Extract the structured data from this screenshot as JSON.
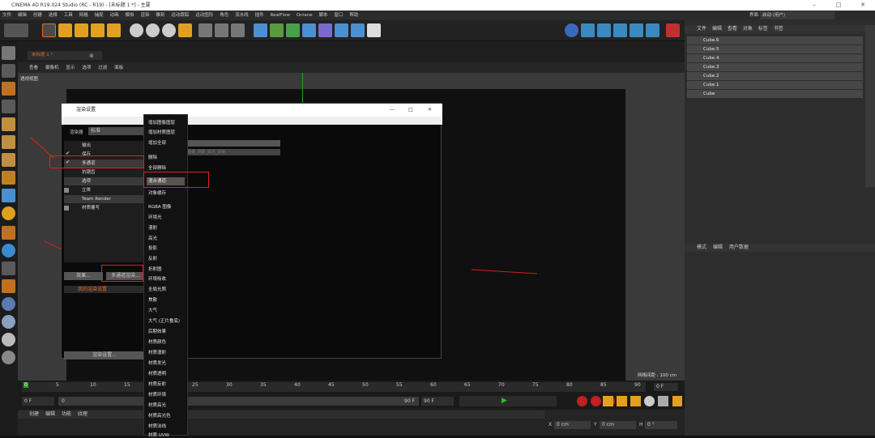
{
  "window": {
    "title": "CINEMA 4D R19.024 Studio (RC - R19) - [未标题 1 *] - 主要"
  },
  "menubar": [
    "文件",
    "编辑",
    "创建",
    "选择",
    "工具",
    "网格",
    "捕捉",
    "动画",
    "模拟",
    "渲染",
    "雕刻",
    "运动跟踪",
    "运动图形",
    "角色",
    "流水线",
    "插件",
    "RealFlow",
    "Octane",
    "脚本",
    "窗口",
    "帮助"
  ],
  "layout": {
    "label": "界面",
    "value": "启动 (用户)"
  },
  "viewport": {
    "tab": "未标题 1 *",
    "menu": [
      "查看",
      "摄像机",
      "显示",
      "选项",
      "过滤",
      "面板"
    ],
    "view_label": "透视视图",
    "grid_spacing": "网格间距 : 100 cm"
  },
  "object_manager": {
    "menu": [
      "文件",
      "编辑",
      "查看",
      "对象",
      "标签",
      "书签"
    ],
    "objects": [
      "Cube.6",
      "Cube.5",
      "Cube.4",
      "Cube.3",
      "Cube.2",
      "Cube.1",
      "Cube"
    ]
  },
  "attribute_manager": {
    "menu": [
      "模式",
      "编辑",
      "用户数据"
    ]
  },
  "render_dialog": {
    "title": "渲染设置",
    "renderer_label": "渲染器",
    "renderer_value": "标准",
    "items": [
      {
        "label": "输出",
        "checked": false
      },
      {
        "label": "保存",
        "checked": true
      },
      {
        "label": "多通道",
        "checked": true
      },
      {
        "label": "抗锯齿",
        "checked": false
      },
      {
        "label": "选项",
        "checked": false
      },
      {
        "label": "立体",
        "checked": false
      },
      {
        "label": "Team Render",
        "checked": false
      },
      {
        "label": "材质覆写",
        "checked": false
      }
    ],
    "effect_button": "效果...",
    "multipass_button": "多通道渲染...",
    "my_settings": "我的渲染设置",
    "render_settings_button": "渲染设置...",
    "field_hint": "图像_阴影_高光_反射"
  },
  "context_menu": {
    "items": [
      "增加图像图层",
      "增加材质图层",
      "增加全部",
      "删除",
      "全部删除",
      "混合通道",
      "对象缓存",
      "RGBA 图像",
      "环境光",
      "漫射",
      "高光",
      "投影",
      "反射",
      "折射图",
      "环境吸收",
      "全局光照",
      "焦散",
      "大气",
      "大气 (正片叠底)",
      "后期效果",
      "材质颜色",
      "材质漫射",
      "材质发光",
      "材质透明",
      "材质反射",
      "材质环境",
      "材质高光",
      "材质高光色",
      "材质法线",
      "材质 UVW"
    ],
    "highlighted": "混合通道"
  },
  "timeline": {
    "ticks": [
      "0",
      "5",
      "10",
      "15",
      "20",
      "25",
      "30",
      "35",
      "40",
      "45",
      "50",
      "55",
      "60",
      "65",
      "70",
      "75",
      "80",
      "85",
      "90"
    ],
    "current": "0 F",
    "start": "0 F",
    "end": "90 F",
    "end2": "90 F",
    "slider_left": "0",
    "slider_right": "90 F"
  },
  "material_panel": {
    "menu": [
      "创建",
      "编辑",
      "功能",
      "纹理"
    ]
  },
  "coords": {
    "x_label": "X",
    "y_label": "Y",
    "h_label": "H",
    "x_value": "0 cm",
    "y_value": "0 cm",
    "h_value": "0 °"
  },
  "colors": {
    "accent": "#e06a2a",
    "highlight_red": "#e02020",
    "dialog_bg": "#0a0a0a"
  }
}
